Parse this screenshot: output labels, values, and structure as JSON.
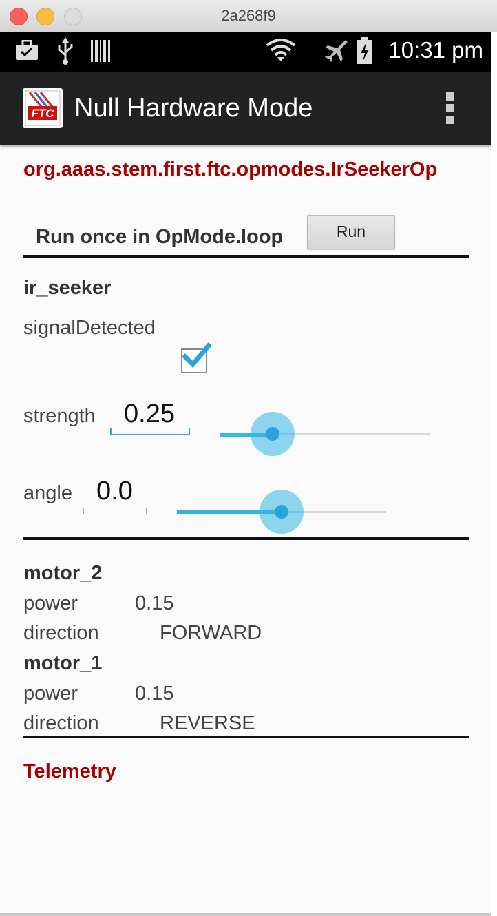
{
  "window": {
    "title": "2a268f9"
  },
  "statusbar": {
    "time": "10:31 pm",
    "icons": [
      "briefcase-icon",
      "usb-icon",
      "barcode-icon",
      "wifi-icon",
      "airplane-mode-icon",
      "battery-charging-icon"
    ]
  },
  "actionbar": {
    "logo_text": "FTC",
    "title": "Null Hardware Mode",
    "overflow_icon": "overflow-menu-icon"
  },
  "opmode": {
    "name": "org.aaas.stem.first.ftc.opmodes.IrSeekerOp",
    "run_label": "Run once in OpMode.loop",
    "run_button": "Run"
  },
  "ir_seeker": {
    "title": "ir_seeker",
    "signal_label": "signalDetected",
    "signal_checked": true,
    "strength_label": "strength",
    "strength_value": "0.25",
    "strength_level": 0.25,
    "angle_label": "angle",
    "angle_value": "0.0",
    "angle_level": 0.5
  },
  "motors": [
    {
      "name": "motor_2",
      "power_label": "power",
      "power": "0.15",
      "direction_label": "direction",
      "direction": "FORWARD"
    },
    {
      "name": "motor_1",
      "power_label": "power",
      "power": "0.15",
      "direction_label": "direction",
      "direction": "REVERSE"
    }
  ],
  "telemetry": {
    "title": "Telemetry"
  },
  "colors": {
    "accent": "#33b5e5",
    "opmode_red": "#a50000",
    "actionbar": "#222222"
  }
}
